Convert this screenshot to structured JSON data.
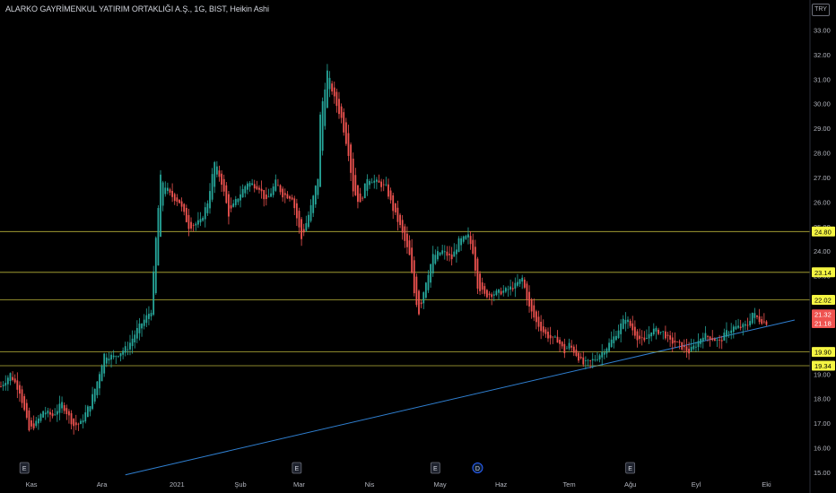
{
  "header": {
    "title": "ALARKO GAYRİMENKUL YATIRIM ORTAKLIĞI A.Ş., 1G, BIST, Heikin Ashi",
    "currency": "TRY"
  },
  "colors": {
    "up": "#26a69a",
    "down": "#ef5350",
    "level_line": "#b8b33a",
    "trend_line": "#2f7fd0",
    "label_bg": "#f5f542",
    "price_label_bg": "#ef5350",
    "axis_text": "#b2b5be"
  },
  "chart_data": {
    "type": "candlestick",
    "ylim": [
      15,
      33.6
    ],
    "yticks": [
      15,
      16,
      17,
      18,
      19,
      20,
      21,
      22,
      23,
      24,
      25,
      26,
      27,
      28,
      29,
      30,
      31,
      32,
      33
    ],
    "ytick_labels": [
      "15.00",
      "16.00",
      "17.00",
      "18.00",
      "19.00",
      "20.00",
      "21.00",
      "22.00",
      "23.00",
      "24.00",
      "25.00",
      "26.00",
      "27.00",
      "28.00",
      "29.00",
      "30.00",
      "31.00",
      "32.00",
      "33.00"
    ],
    "x_labels": [
      "Kas",
      "Ara",
      "2021",
      "Şub",
      "Mar",
      "Nis",
      "May",
      "Haz",
      "Tem",
      "Ağu",
      "Eyl",
      "Eki"
    ],
    "x_label_bar_index": [
      13,
      43,
      75,
      102,
      127,
      157,
      187,
      213,
      242,
      268,
      296,
      326
    ],
    "horizontal_levels": [
      {
        "value": 24.8,
        "label": "24.80"
      },
      {
        "value": 23.14,
        "label": "23.14"
      },
      {
        "value": 22.02,
        "label": "22.02"
      },
      {
        "value": 19.9,
        "label": "19.90"
      },
      {
        "value": 19.34,
        "label": "19.34"
      }
    ],
    "price_labels": [
      {
        "value": 21.32,
        "label": "21.32"
      },
      {
        "value": 21.18,
        "label": "21.18"
      }
    ],
    "trendline": {
      "from": {
        "bar": 53,
        "value": 14.9
      },
      "to": {
        "bar": 338,
        "value": 21.2
      }
    },
    "event_markers": [
      {
        "bar": 10,
        "label": "E"
      },
      {
        "bar": 126,
        "label": "E"
      },
      {
        "bar": 185,
        "label": "E"
      },
      {
        "bar": 203,
        "label": "D"
      },
      {
        "bar": 268,
        "label": "E"
      }
    ],
    "waypoints": [
      [
        0,
        18.5
      ],
      [
        4,
        19.0
      ],
      [
        8,
        18.3
      ],
      [
        12,
        16.7
      ],
      [
        15,
        17.0
      ],
      [
        18,
        17.5
      ],
      [
        22,
        17.3
      ],
      [
        26,
        17.8
      ],
      [
        31,
        16.9
      ],
      [
        34,
        17.0
      ],
      [
        38,
        17.8
      ],
      [
        41,
        18.7
      ],
      [
        44,
        19.8
      ],
      [
        48,
        19.7
      ],
      [
        54,
        20.1
      ],
      [
        58,
        20.8
      ],
      [
        61,
        21.2
      ],
      [
        64,
        21.6
      ],
      [
        66,
        24.5
      ],
      [
        68,
        27.0
      ],
      [
        72,
        26.3
      ],
      [
        76,
        26.0
      ],
      [
        80,
        25.0
      ],
      [
        85,
        25.2
      ],
      [
        88,
        26.0
      ],
      [
        91,
        27.6
      ],
      [
        94,
        26.8
      ],
      [
        97,
        25.5
      ],
      [
        101,
        26.2
      ],
      [
        105,
        26.8
      ],
      [
        110,
        26.6
      ],
      [
        113,
        26.0
      ],
      [
        117,
        26.8
      ],
      [
        120,
        26.3
      ],
      [
        124,
        26.2
      ],
      [
        128,
        24.5
      ],
      [
        132,
        25.8
      ],
      [
        135,
        27.0
      ],
      [
        136,
        29.5
      ],
      [
        139,
        31.3
      ],
      [
        142,
        30.2
      ],
      [
        145,
        29.4
      ],
      [
        148,
        28.0
      ],
      [
        150,
        26.5
      ],
      [
        153,
        25.9
      ],
      [
        156,
        27.0
      ],
      [
        160,
        26.8
      ],
      [
        164,
        26.6
      ],
      [
        167,
        25.7
      ],
      [
        170,
        25.0
      ],
      [
        174,
        23.8
      ],
      [
        176,
        22.3
      ],
      [
        178,
        21.5
      ],
      [
        181,
        22.8
      ],
      [
        184,
        23.8
      ],
      [
        188,
        24.0
      ],
      [
        192,
        23.7
      ],
      [
        195,
        24.4
      ],
      [
        199,
        24.6
      ],
      [
        201,
        24.0
      ],
      [
        203,
        22.6
      ],
      [
        206,
        22.2
      ],
      [
        211,
        22.3
      ],
      [
        215,
        22.4
      ],
      [
        219,
        22.6
      ],
      [
        222,
        22.9
      ],
      [
        225,
        21.7
      ],
      [
        228,
        21.1
      ],
      [
        232,
        20.6
      ],
      [
        235,
        20.4
      ],
      [
        237,
        20.4
      ],
      [
        240,
        19.9
      ],
      [
        242,
        20.2
      ],
      [
        245,
        19.8
      ],
      [
        248,
        19.4
      ],
      [
        251,
        19.5
      ],
      [
        254,
        19.7
      ],
      [
        258,
        20.1
      ],
      [
        261,
        20.5
      ],
      [
        264,
        21.0
      ],
      [
        266,
        21.3
      ],
      [
        269,
        20.8
      ],
      [
        271,
        20.5
      ],
      [
        274,
        20.3
      ],
      [
        277,
        20.8
      ],
      [
        282,
        20.7
      ],
      [
        285,
        20.3
      ],
      [
        287,
        20.3
      ],
      [
        290,
        20.1
      ],
      [
        293,
        19.9
      ],
      [
        296,
        20.2
      ],
      [
        299,
        20.6
      ],
      [
        302,
        20.5
      ],
      [
        306,
        20.3
      ],
      [
        309,
        20.7
      ],
      [
        312,
        20.9
      ],
      [
        315,
        20.9
      ],
      [
        318,
        21.0
      ],
      [
        320,
        21.5
      ],
      [
        323,
        21.2
      ],
      [
        326,
        21.1
      ]
    ]
  }
}
